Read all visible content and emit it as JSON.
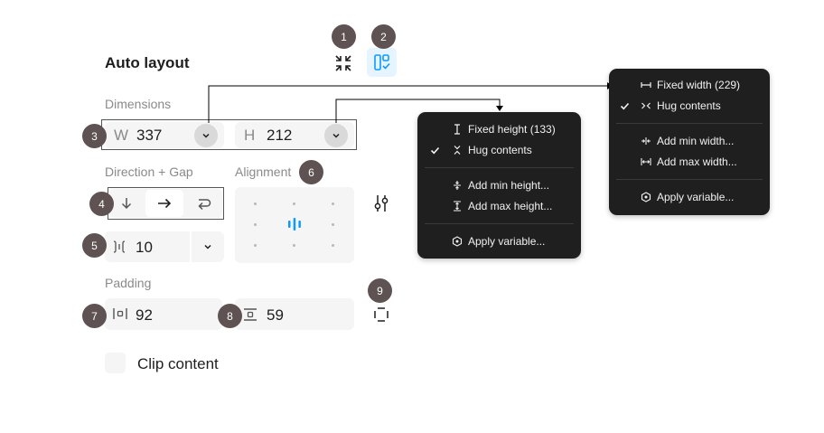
{
  "panel": {
    "title": "Auto layout",
    "dimensions_label": "Dimensions",
    "width": {
      "prefix": "W",
      "value": "337"
    },
    "height": {
      "prefix": "H",
      "value": "212"
    },
    "direction_gap_label": "Direction + Gap",
    "alignment_label": "Alignment",
    "gap_value": "10",
    "padding_label": "Padding",
    "padding_horizontal": "92",
    "padding_vertical": "59",
    "clip_content_label": "Clip content",
    "clip_content_checked": false
  },
  "badges": [
    "1",
    "2",
    "3",
    "4",
    "5",
    "6",
    "7",
    "8",
    "9"
  ],
  "height_menu": {
    "items": [
      "Fixed height (133)",
      "Hug contents",
      "Add min height...",
      "Add max height...",
      "Apply variable..."
    ],
    "checked_item": "Hug contents"
  },
  "width_menu": {
    "items": [
      "Fixed width (229)",
      "Hug contents",
      "Add min width...",
      "Add max width...",
      "Apply variable..."
    ],
    "checked_item": "Hug contents"
  },
  "colors": {
    "badge": "#5e5252",
    "menu_bg": "#1f1f1f",
    "field_bg": "#f5f5f5",
    "accent": "#0d99ff",
    "selected_button_bg": "#e5f4ff"
  }
}
